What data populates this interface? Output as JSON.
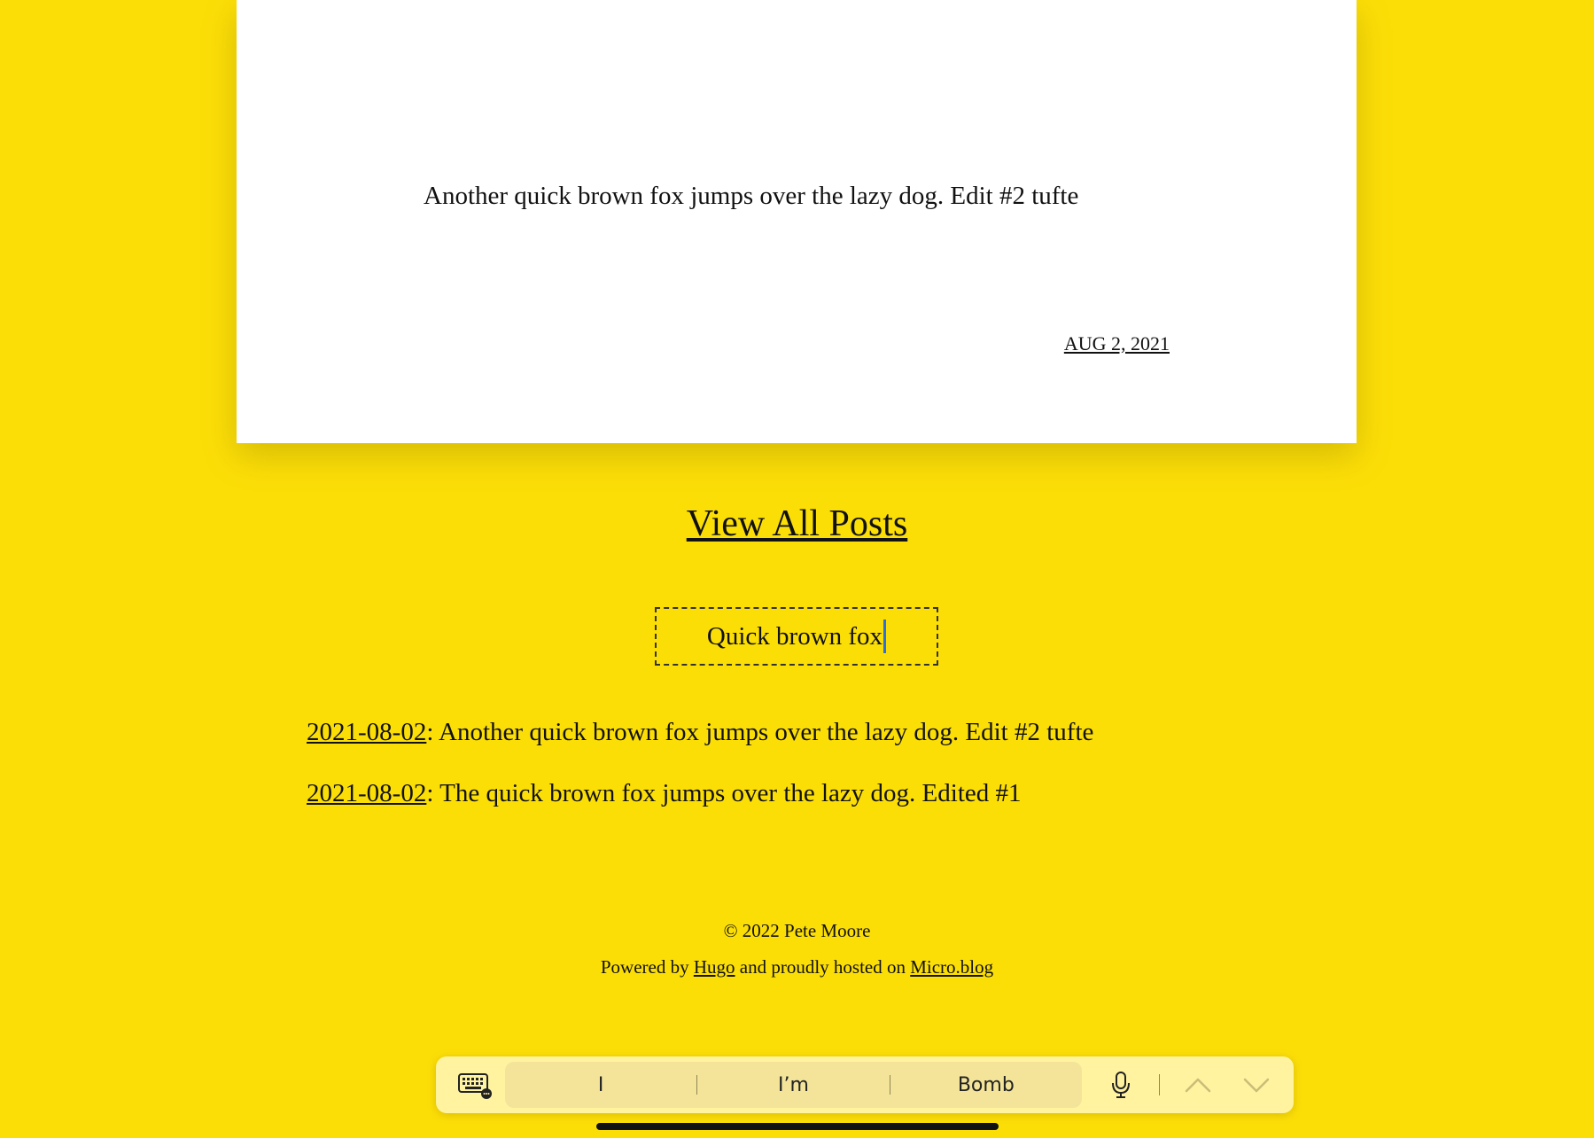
{
  "post": {
    "text": "Another quick brown fox jumps over the lazy dog. Edit #2 tufte",
    "date": "AUG 2, 2021"
  },
  "view_all_label": "View All Posts",
  "search": {
    "value": "Quick brown fox"
  },
  "results": [
    {
      "date": "2021-08-02",
      "separator": ":",
      "text": " Another quick brown fox jumps over the lazy dog. Edit #2 tufte"
    },
    {
      "date": "2021-08-02",
      "separator": ":",
      "text": " The quick brown fox jumps over the lazy dog. Edited #1"
    }
  ],
  "footer": {
    "copyright": "© 2022 Pete Moore",
    "powered_prefix": "Powered by ",
    "hugo_link": "Hugo",
    "powered_middle": " and proudly hosted on ",
    "microblog_link": "Micro.blog"
  },
  "keyboard_bar": {
    "suggestions": [
      "I",
      "I’m",
      "Bomb"
    ],
    "icons": {
      "keyboard": "keyboard-icon",
      "mic": "microphone-icon",
      "up": "chevron-up-icon",
      "down": "chevron-down-icon"
    }
  },
  "colors": {
    "page_background": "#FCDE07",
    "card_background": "#FFFFFF",
    "caret": "#2F6FD6"
  }
}
